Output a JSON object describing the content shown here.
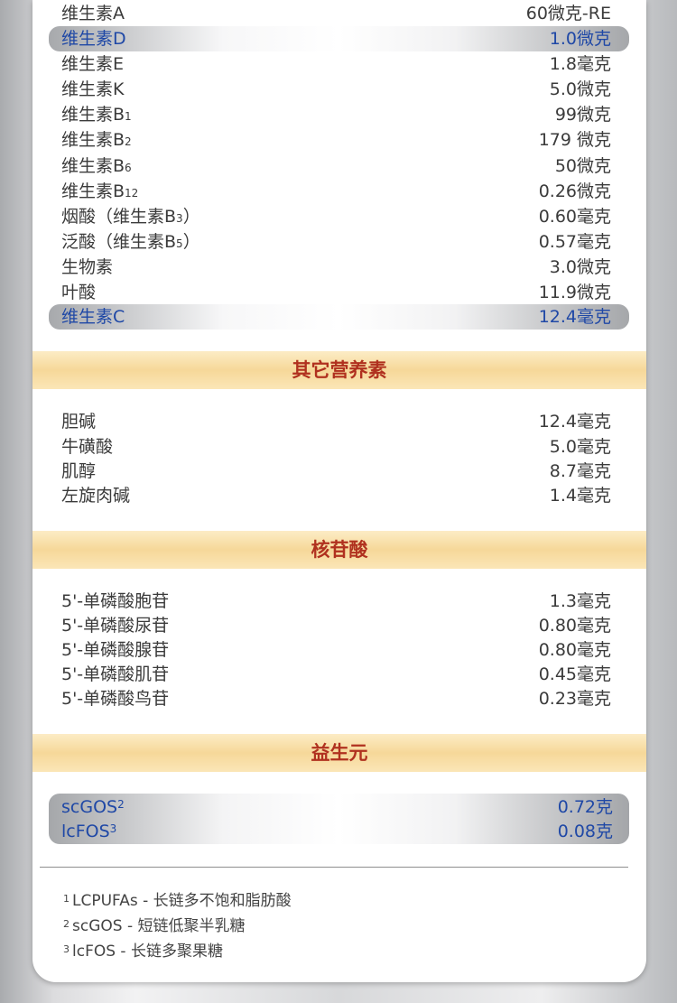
{
  "vitamins": [
    {
      "label": "维生素A",
      "sub": "",
      "suffix": "",
      "value": "60微克-RE"
    },
    {
      "label": "维生素D",
      "sub": "",
      "suffix": "",
      "value": "1.0微克"
    },
    {
      "label": "维生素E",
      "sub": "",
      "suffix": "",
      "value": "1.8毫克"
    },
    {
      "label": "维生素K",
      "sub": "",
      "suffix": "",
      "value": "5.0微克"
    },
    {
      "label": "维生素B",
      "sub": "1",
      "suffix": "",
      "value": "99微克"
    },
    {
      "label": "维生素B",
      "sub": "2",
      "suffix": "",
      "value": "179 微克"
    },
    {
      "label": "维生素B",
      "sub": "6",
      "suffix": "",
      "value": "50微克"
    },
    {
      "label": "维生素B",
      "sub": "12",
      "suffix": "",
      "value": "0.26微克"
    },
    {
      "label": "烟酸（维生素B",
      "sub": "3",
      "suffix": "）",
      "value": "0.60毫克"
    },
    {
      "label": "泛酸（维生素B",
      "sub": "5",
      "suffix": "）",
      "value": "0.57毫克"
    },
    {
      "label": "生物素",
      "sub": "",
      "suffix": "",
      "value": "3.0微克"
    },
    {
      "label": "叶酸",
      "sub": "",
      "suffix": "",
      "value": "11.9微克"
    },
    {
      "label": "维生素C",
      "sub": "",
      "suffix": "",
      "value": "12.4毫克"
    }
  ],
  "other_nutrients": {
    "title": "其它营养素",
    "items": [
      {
        "label": "胆碱",
        "value": "12.4毫克"
      },
      {
        "label": "牛磺酸",
        "value": "5.0毫克"
      },
      {
        "label": "肌醇",
        "value": "8.7毫克"
      },
      {
        "label": "左旋肉碱",
        "value": "1.4毫克"
      }
    ]
  },
  "nucleotides": {
    "title": "核苷酸",
    "items": [
      {
        "label": "5'-单磷酸胞苷",
        "value": "1.3毫克"
      },
      {
        "label": "5'-单磷酸尿苷",
        "value": "0.80毫克"
      },
      {
        "label": "5'-单磷酸腺苷",
        "value": "0.80毫克"
      },
      {
        "label": "5'-单磷酸肌苷",
        "value": "0.45毫克"
      },
      {
        "label": "5'-单磷酸鸟苷",
        "value": "0.23毫克"
      }
    ]
  },
  "prebiotics": {
    "title": "益生元",
    "items": [
      {
        "label": "scGOS",
        "sup": "2",
        "value": "0.72克"
      },
      {
        "label": "lcFOS",
        "sup": "3",
        "value": "0.08克"
      }
    ]
  },
  "footnotes": [
    {
      "num": "1",
      "text": "LCPUFAs - 长链多不饱和脂肪酸"
    },
    {
      "num": "2",
      "text": "scGOS - 短链低聚半乳糖"
    },
    {
      "num": "3",
      "text": "lcFOS - 长链多聚果糖"
    }
  ],
  "colors": {
    "highlight_text": "#1f48a6",
    "section_title": "#b0311f",
    "band": "#f6d899"
  }
}
